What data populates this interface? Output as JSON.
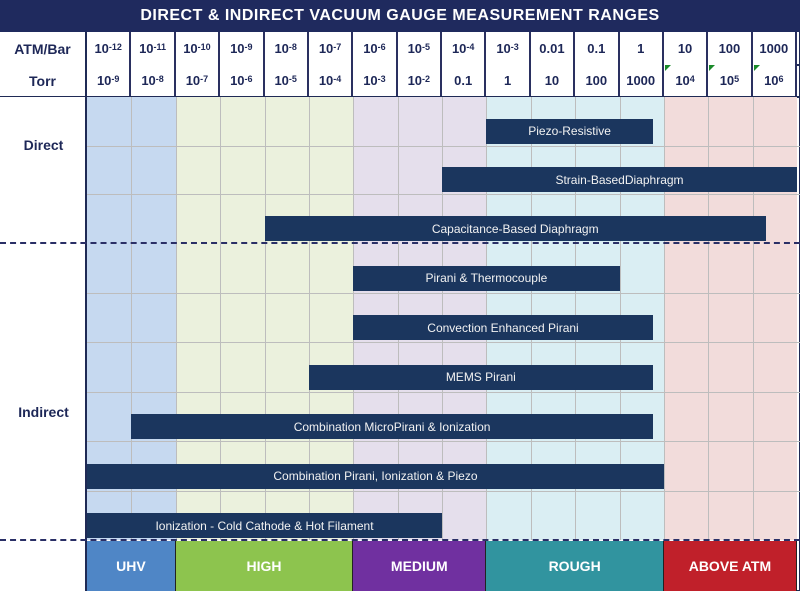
{
  "chart_data": {
    "type": "table",
    "title": "DIRECT & INDIRECT VACUUM GAUGE MEASUREMENT RANGES",
    "header_rows": [
      {
        "label": "ATM/Bar",
        "values": [
          {
            "base": "10",
            "exp": "-12"
          },
          {
            "base": "10",
            "exp": "-11"
          },
          {
            "base": "10",
            "exp": "-10"
          },
          {
            "base": "10",
            "exp": "-9"
          },
          {
            "base": "10",
            "exp": "-8"
          },
          {
            "base": "10",
            "exp": "-7"
          },
          {
            "base": "10",
            "exp": "-6"
          },
          {
            "base": "10",
            "exp": "-5"
          },
          {
            "base": "10",
            "exp": "-4"
          },
          {
            "base": "10",
            "exp": "-3"
          },
          {
            "base": "0.01",
            "exp": ""
          },
          {
            "base": "0.1",
            "exp": ""
          },
          {
            "base": "1",
            "exp": ""
          },
          {
            "base": "10",
            "exp": ""
          },
          {
            "base": "100",
            "exp": ""
          },
          {
            "base": "1000",
            "exp": ""
          }
        ]
      },
      {
        "label": "Torr",
        "values": [
          {
            "base": "10",
            "exp": "-9"
          },
          {
            "base": "10",
            "exp": "-8"
          },
          {
            "base": "10",
            "exp": "-7"
          },
          {
            "base": "10",
            "exp": "-6"
          },
          {
            "base": "10",
            "exp": "-5"
          },
          {
            "base": "10",
            "exp": "-4"
          },
          {
            "base": "10",
            "exp": "-3"
          },
          {
            "base": "10",
            "exp": "-2"
          },
          {
            "base": "0.1",
            "exp": ""
          },
          {
            "base": "1",
            "exp": ""
          },
          {
            "base": "10",
            "exp": ""
          },
          {
            "base": "100",
            "exp": ""
          },
          {
            "base": "1000",
            "exp": ""
          },
          {
            "base": "10",
            "exp": "4"
          },
          {
            "base": "10",
            "exp": "5"
          },
          {
            "base": "10",
            "exp": "6"
          }
        ]
      }
    ],
    "groups": [
      {
        "label": "Direct",
        "gauges": [
          {
            "name": "Piezo-Resistive",
            "label": "Piezo-Resistive",
            "range_columns": [
              9,
              12.75
            ]
          },
          {
            "name": "Strain-Based Diaphragm",
            "label": "Strain-BasedDiaphragm",
            "range_columns": [
              8,
              16
            ]
          },
          {
            "name": "Capacitance-Based Diaphragm",
            "label": "Capacitance-Based Diaphragm",
            "range_columns": [
              4,
              15.3
            ]
          }
        ]
      },
      {
        "label": "Indirect",
        "gauges": [
          {
            "name": "Pirani & Thermocouple",
            "label": "Pirani & Thermocouple",
            "range_columns": [
              6,
              12
            ]
          },
          {
            "name": "Convection Enhanced Pirani",
            "label": "Convection Enhanced Pirani",
            "range_columns": [
              6,
              12.75
            ]
          },
          {
            "name": "MEMS Pirani",
            "label": "MEMS Pirani",
            "range_columns": [
              5,
              12.75
            ]
          },
          {
            "name": "Combination MicroPirani & Ionization",
            "label": "Combination MicroPirani & Ionization",
            "range_columns": [
              1,
              12.75
            ]
          },
          {
            "name": "Combination Pirani, Ionization & Piezo",
            "label": "Combination Pirani, Ionization & Piezo",
            "range_columns": [
              0,
              13
            ]
          },
          {
            "name": "Ionization - Cold Cathode & Hot Filament",
            "label": "Ionization - Cold Cathode & Hot Filament",
            "range_columns": [
              0,
              8
            ]
          }
        ]
      }
    ],
    "zones": [
      {
        "label": "UHV",
        "columns": [
          0,
          2
        ],
        "band_color": "#4f86c6",
        "bg_color": "#c6d9f0"
      },
      {
        "label": "HIGH",
        "columns": [
          2,
          6
        ],
        "band_color": "#8dc44e",
        "bg_color": "#ebf1dd"
      },
      {
        "label": "MEDIUM",
        "columns": [
          6,
          9
        ],
        "band_color": "#7030a0",
        "bg_color": "#e5dfec"
      },
      {
        "label": "ROUGH",
        "columns": [
          9,
          13
        ],
        "band_color": "#31949f",
        "bg_color": "#daeef3"
      },
      {
        "label": "ABOVE ATM",
        "columns": [
          13,
          16
        ],
        "band_color": "#c0202a",
        "bg_color": "#f2dcdb"
      }
    ]
  },
  "colors": {
    "title_bg": "#1f2a5e",
    "bar": "#1b365e",
    "header_text": "#1d2757"
  }
}
